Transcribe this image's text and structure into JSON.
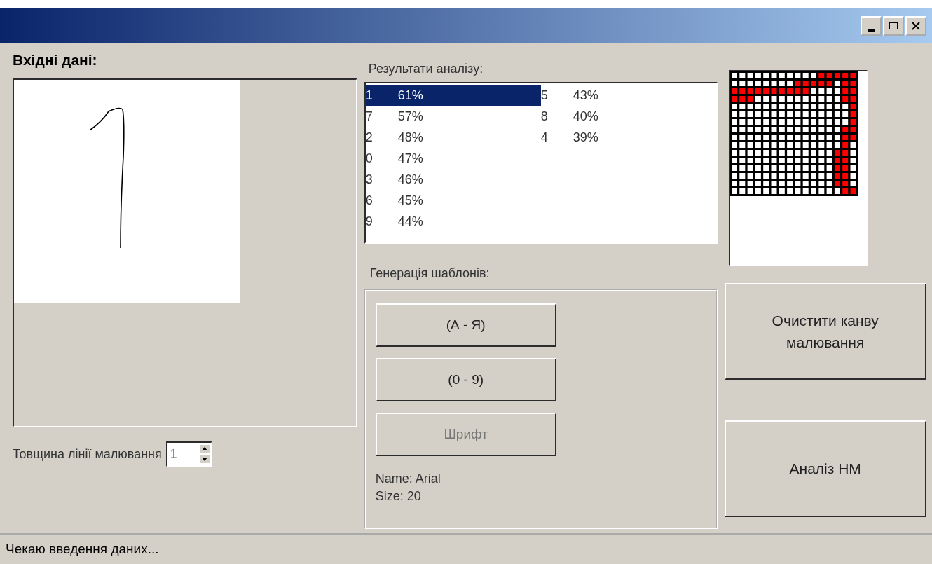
{
  "input": {
    "heading": "Вхідні дані:",
    "line_width": {
      "label": "Товщина лінії малювання",
      "value": "1"
    }
  },
  "results": {
    "heading": "Результати аналізу:",
    "items": [
      {
        "digit": "1",
        "percent": "61%",
        "selected": true
      },
      {
        "digit": "7",
        "percent": "57%",
        "selected": false
      },
      {
        "digit": "2",
        "percent": "48%",
        "selected": false
      },
      {
        "digit": "0",
        "percent": "47%",
        "selected": false
      },
      {
        "digit": "3",
        "percent": "46%",
        "selected": false
      },
      {
        "digit": "6",
        "percent": "45%",
        "selected": false
      },
      {
        "digit": "9",
        "percent": "44%",
        "selected": false
      },
      {
        "digit": "5",
        "percent": "43%",
        "selected": false
      },
      {
        "digit": "8",
        "percent": "40%",
        "selected": false
      },
      {
        "digit": "4",
        "percent": "39%",
        "selected": false
      }
    ]
  },
  "templates": {
    "heading": "Генерація шаблонів:",
    "buttons": [
      {
        "label": "(А - Я)",
        "disabled": false
      },
      {
        "label": "(0 - 9)",
        "disabled": false
      },
      {
        "label": "Шрифт",
        "disabled": true
      }
    ],
    "font_name": "Name: Arial",
    "font_size": "Size: 20"
  },
  "actions": [
    "Очистити канву малювання",
    "Аналіз НМ"
  ],
  "status_bar": "Чекаю введення даних..."
}
